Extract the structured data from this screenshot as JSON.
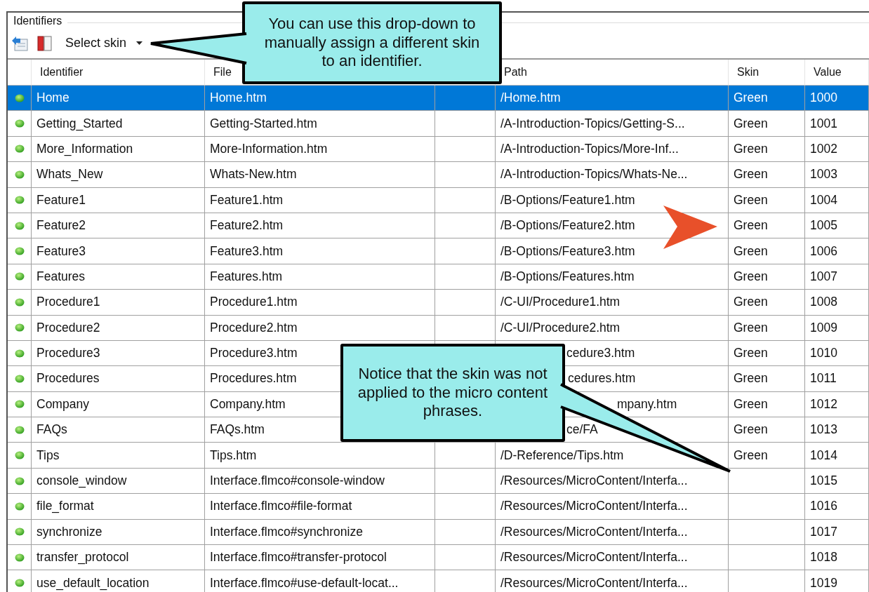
{
  "group": {
    "title": "Identifiers"
  },
  "toolbar": {
    "skin_dropdown": {
      "label": "Select skin"
    }
  },
  "table": {
    "columns": [
      "Identifier",
      "File",
      "Path",
      "Skin",
      "Value"
    ],
    "rows": [
      {
        "identifier": "Home",
        "file": "Home.htm",
        "path": "/Home.htm",
        "skin": "Green",
        "value": "1000",
        "selected": true,
        "obscured": false
      },
      {
        "identifier": "Getting_Started",
        "file": "Getting-Started.htm",
        "path": "/A-Introduction-Topics/Getting-S...",
        "skin": "Green",
        "value": "1001",
        "selected": false,
        "obscured": false
      },
      {
        "identifier": "More_Information",
        "file": "More-Information.htm",
        "path": "/A-Introduction-Topics/More-Inf...",
        "skin": "Green",
        "value": "1002",
        "selected": false,
        "obscured": false
      },
      {
        "identifier": "Whats_New",
        "file": "Whats-New.htm",
        "path": "/A-Introduction-Topics/Whats-Ne...",
        "skin": "Green",
        "value": "1003",
        "selected": false,
        "obscured": false
      },
      {
        "identifier": "Feature1",
        "file": "Feature1.htm",
        "path": "/B-Options/Feature1.htm",
        "skin": "Green",
        "value": "1004",
        "selected": false,
        "obscured": false
      },
      {
        "identifier": "Feature2",
        "file": "Feature2.htm",
        "path": "/B-Options/Feature2.htm",
        "skin": "Green",
        "value": "1005",
        "selected": false,
        "obscured": false
      },
      {
        "identifier": "Feature3",
        "file": "Feature3.htm",
        "path": "/B-Options/Feature3.htm",
        "skin": "Green",
        "value": "1006",
        "selected": false,
        "obscured": false
      },
      {
        "identifier": "Features",
        "file": "Features.htm",
        "path": "/B-Options/Features.htm",
        "skin": "Green",
        "value": "1007",
        "selected": false,
        "obscured": false
      },
      {
        "identifier": "Procedure1",
        "file": "Procedure1.htm",
        "path": "/C-UI/Procedure1.htm",
        "skin": "Green",
        "value": "1008",
        "selected": false,
        "obscured": false
      },
      {
        "identifier": "Procedure2",
        "file": "Procedure2.htm",
        "path": "/C-UI/Procedure2.htm",
        "skin": "Green",
        "value": "1009",
        "selected": false,
        "obscured": false
      },
      {
        "identifier": "Procedure3",
        "file": "Procedure3.htm",
        "path": "cedure3.htm",
        "skin": "Green",
        "value": "1010",
        "selected": false,
        "obscured": true
      },
      {
        "identifier": "Procedures",
        "file": "Procedures.htm",
        "path": "cedures.htm",
        "skin": "Green",
        "value": "1011",
        "selected": false,
        "obscured": true
      },
      {
        "identifier": "Company",
        "file": "Company.htm",
        "path": "mpany.htm",
        "skin": "Green",
        "value": "1012",
        "selected": false,
        "obscured": true
      },
      {
        "identifier": "FAQs",
        "file": "FAQs.htm",
        "path": "ce/FA",
        "skin": "Green",
        "value": "1013",
        "selected": false,
        "obscured": true
      },
      {
        "identifier": "Tips",
        "file": "Tips.htm",
        "path": "/D-Reference/Tips.htm",
        "skin": "Green",
        "value": "1014",
        "selected": false,
        "obscured": false
      },
      {
        "identifier": "console_window",
        "file": "Interface.flmco#console-window",
        "path": "/Resources/MicroContent/Interfa...",
        "value": "1015",
        "selected": false,
        "obscured": false
      },
      {
        "identifier": "file_format",
        "file": "Interface.flmco#file-format",
        "path": "/Resources/MicroContent/Interfa...",
        "value": "1016",
        "selected": false,
        "obscured": false
      },
      {
        "identifier": "synchronize",
        "file": "Interface.flmco#synchronize",
        "path": "/Resources/MicroContent/Interfa...",
        "value": "1017",
        "selected": false,
        "obscured": false
      },
      {
        "identifier": "transfer_protocol",
        "file": "Interface.flmco#transfer-protocol",
        "path": "/Resources/MicroContent/Interfa...",
        "value": "1018",
        "selected": false,
        "obscured": false
      },
      {
        "identifier": "use_default_location",
        "file": "Interface.flmco#use-default-locat...",
        "path": "/Resources/MicroContent/Interfa...",
        "value": "1019",
        "selected": false,
        "obscured": false
      }
    ]
  },
  "callouts": [
    {
      "text": "You can use this drop-down to manually assign a different skin to an identifier."
    },
    {
      "text": "Notice that the skin was not applied to the micro content phrases."
    }
  ]
}
